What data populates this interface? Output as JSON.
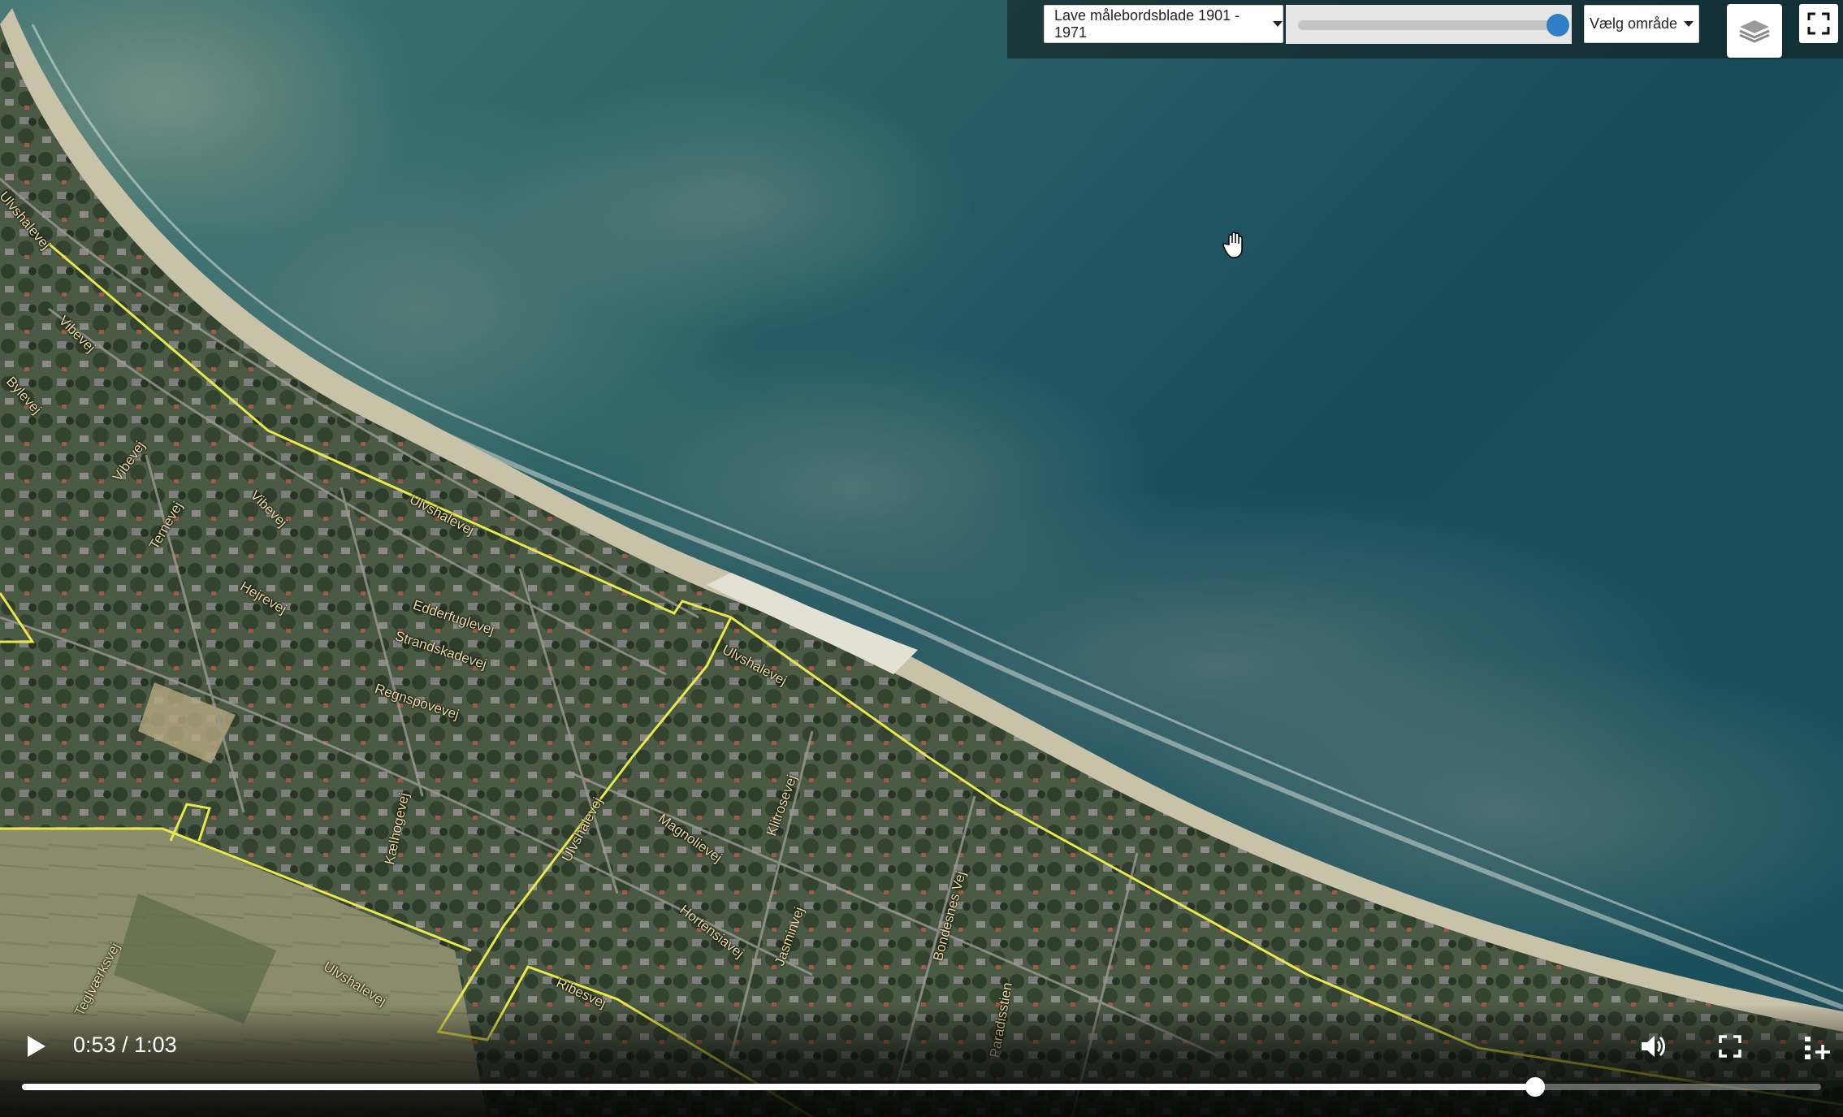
{
  "map_controls": {
    "layer_select_label": "Lave målebordsblade 1901 - 1971",
    "opacity_level": 1.0,
    "area_select_label": "Vælg område",
    "layers_icon": "layers-icon",
    "fullscreen_icon": "expand-icon"
  },
  "map": {
    "labels": [
      {
        "text": "Ulvshalevej"
      },
      {
        "text": "Vibevej"
      },
      {
        "text": "Bylevej"
      },
      {
        "text": "Vibevej"
      },
      {
        "text": "Ternevej"
      },
      {
        "text": "Vibevej"
      },
      {
        "text": "Hejrevej"
      },
      {
        "text": "Ulvshalevej"
      },
      {
        "text": "Edderfuglevej"
      },
      {
        "text": "Strandskadevej"
      },
      {
        "text": "Regnspovevej"
      },
      {
        "text": "Ulvshalevej"
      },
      {
        "text": "Kælhogevej"
      },
      {
        "text": "Ulvshalevej"
      },
      {
        "text": "Magnolievej"
      },
      {
        "text": "Klitrosevej"
      },
      {
        "text": "Hortensiavej"
      },
      {
        "text": "Jasminvej"
      },
      {
        "text": "Bondesnes Vej"
      },
      {
        "text": "Paradisstien"
      },
      {
        "text": "Ulvshalevej"
      },
      {
        "text": "Teglværksvej"
      },
      {
        "text": "Ribesvej"
      }
    ]
  },
  "player": {
    "current_time": "0:53",
    "separator": " / ",
    "duration": "1:03",
    "progress": 0.841,
    "play_icon": "play-icon",
    "volume_icon": "volume-icon",
    "fullscreen_icon": "fullscreen-icon",
    "more_icon": "playlist-add-icon"
  }
}
